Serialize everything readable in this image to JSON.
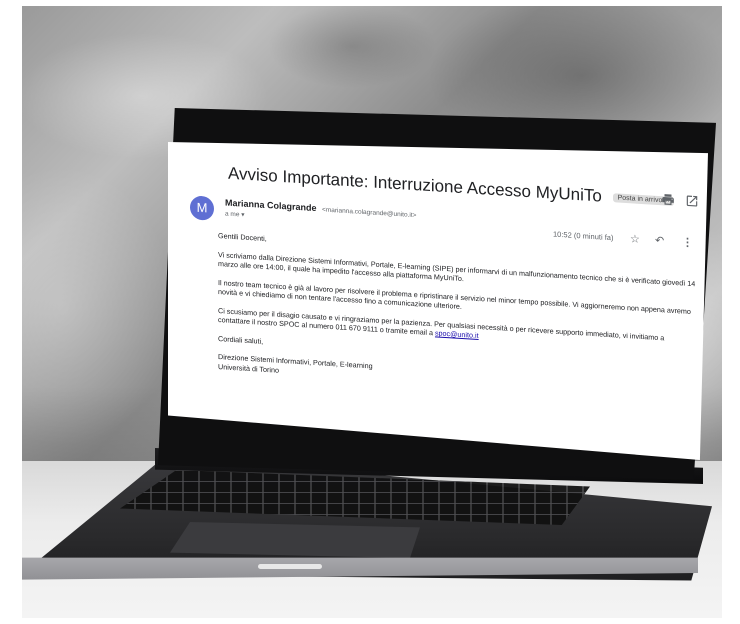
{
  "email": {
    "subject": "Avviso Importante: Interruzione Accesso MyUniTo",
    "label": "Posta in arrivo",
    "label_close": "×",
    "avatar_initial": "M",
    "sender_name": "Marianna Colagrande",
    "sender_email": "<marianna.colagrande@unito.it>",
    "to": "a me",
    "time": "10:52 (0 minuti fa)",
    "greeting": "Gentili Docenti,",
    "paragraph1": "Vi scriviamo dalla Direzione Sistemi Informativi, Portale, E-learning (SIPE) per informarvi di un malfunzionamento tecnico che si è verificato giovedì 14 marzo alle ore 14:00, il quale ha impedito l'accesso alla piattaforma MyUniTo.",
    "paragraph2": "Il nostro team tecnico è già al lavoro per risolvere il problema e ripristinare il servizio nel minor tempo possibile. Vi aggiorneremo non appena avremo novità e vi chiediamo di non tentare l'accesso fino a comunicazione ulteriore.",
    "paragraph3_text": "Ci scusiamo per il disagio causato e vi ringraziamo per la pazienza. Per qualsiasi necessità o per ricevere supporto immediato, vi invitiamo a contattare il nostro SPOC al numero 011 670 9111 o tramite email a",
    "paragraph3_link": "spoc@unito.it",
    "closing": "Cordiali saluti,",
    "signature_line1": "Direzione Sistemi Informativi, Portale, E-learning",
    "signature_line2": "Università di Torino"
  },
  "icons": {
    "print": "printer-icon",
    "open_new_window": "external-link-icon",
    "star": "star-icon",
    "reply": "reply-icon",
    "more": "more-vertical-icon"
  },
  "colors": {
    "avatar": "#5f6fd3",
    "link": "#1a0dab"
  }
}
